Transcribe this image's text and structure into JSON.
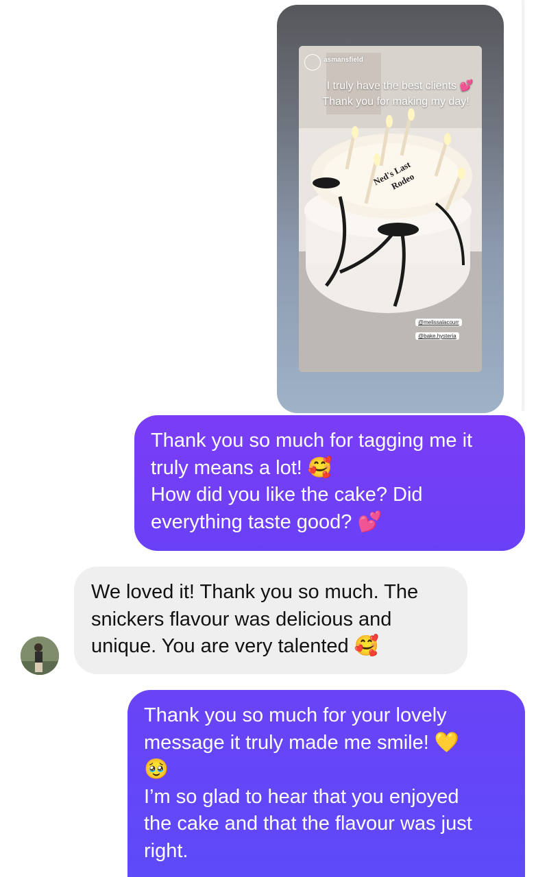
{
  "story": {
    "username": "asmansfield",
    "caption_line1": "I truly have the best clients 💕",
    "caption_line2": "Thank you for making my day!",
    "tag1": "@melissalacourr",
    "tag2": "@bake.hysteria",
    "cake_text_line1": "Ned's Last",
    "cake_text_line2": "Rodeo"
  },
  "messages": [
    {
      "type": "sent",
      "text": "Thank you so much for tagging me it\ntruly means a lot! 🥰\nHow did you like the cake? Did\neverything taste good? 💕"
    },
    {
      "type": "received",
      "text": "We loved it! Thank you so much. The\nsnickers flavour was delicious and\nunique. You are very talented 🥰"
    },
    {
      "type": "sent",
      "text": "Thank you so much for your lovely\nmessage it truly made me smile! 💛\n🥹\nI’m so glad to hear that you enjoyed\nthe cake and that the flavour was just\nright."
    }
  ],
  "colors": {
    "sent_bubble": "#6a40f7",
    "received_bubble": "#efeff0"
  }
}
